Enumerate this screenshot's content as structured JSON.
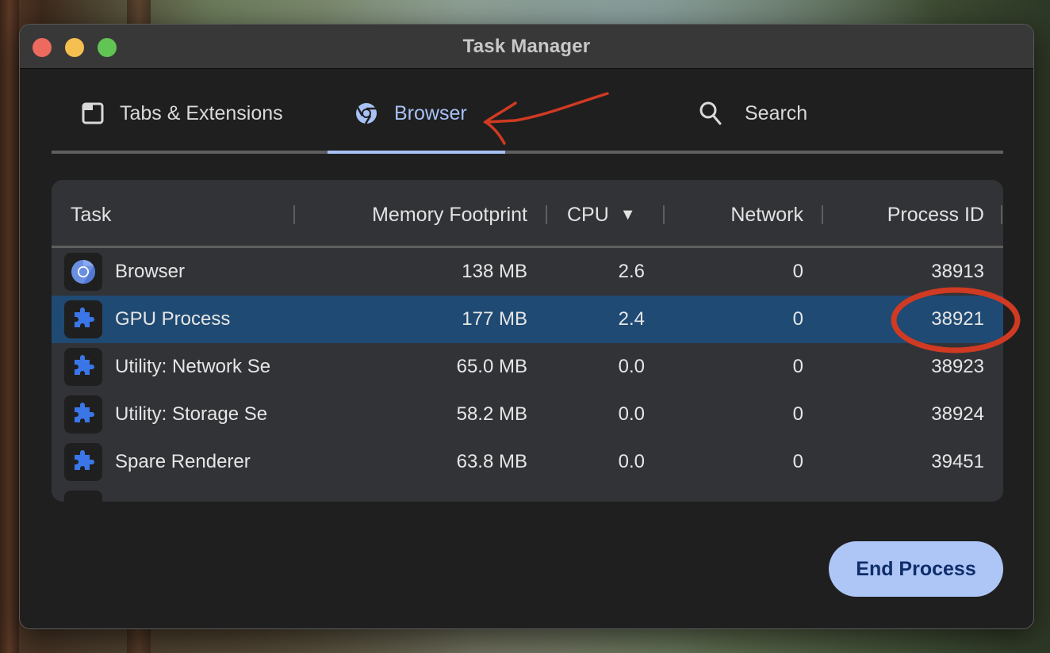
{
  "window": {
    "title": "Task Manager"
  },
  "tabs": [
    {
      "label": "Tabs & Extensions",
      "icon": "tab-window-icon",
      "active": false
    },
    {
      "label": "Browser",
      "icon": "chrome-icon",
      "active": true
    },
    {
      "label": "Search",
      "icon": "search-icon",
      "active": false
    }
  ],
  "table": {
    "columns": {
      "task": "Task",
      "memory": "Memory Footprint",
      "cpu": "CPU",
      "cpu_sort": "▼",
      "network": "Network",
      "pid": "Process ID"
    },
    "rows": [
      {
        "icon": "chromium-icon",
        "task": "Browser",
        "memory": "138 MB",
        "cpu": "2.6",
        "network": "0",
        "pid": "38913",
        "selected": false
      },
      {
        "icon": "puzzle-icon",
        "task": "GPU Process",
        "memory": "177 MB",
        "cpu": "2.4",
        "network": "0",
        "pid": "38921",
        "selected": true
      },
      {
        "icon": "puzzle-icon",
        "task": "Utility: Network Se",
        "memory": "65.0 MB",
        "cpu": "0.0",
        "network": "0",
        "pid": "38923",
        "selected": false
      },
      {
        "icon": "puzzle-icon",
        "task": "Utility: Storage Se",
        "memory": "58.2 MB",
        "cpu": "0.0",
        "network": "0",
        "pid": "38924",
        "selected": false
      },
      {
        "icon": "puzzle-icon",
        "task": "Spare Renderer",
        "memory": "63.8 MB",
        "cpu": "0.0",
        "network": "0",
        "pid": "39451",
        "selected": false
      }
    ]
  },
  "footer": {
    "end_process_label": "End Process"
  },
  "colors": {
    "accent": "#a8c1f5",
    "selected_row": "#1f4a73",
    "button_bg": "#aec6f6",
    "button_text": "#0f2d6b",
    "annotation": "#d03a22"
  }
}
